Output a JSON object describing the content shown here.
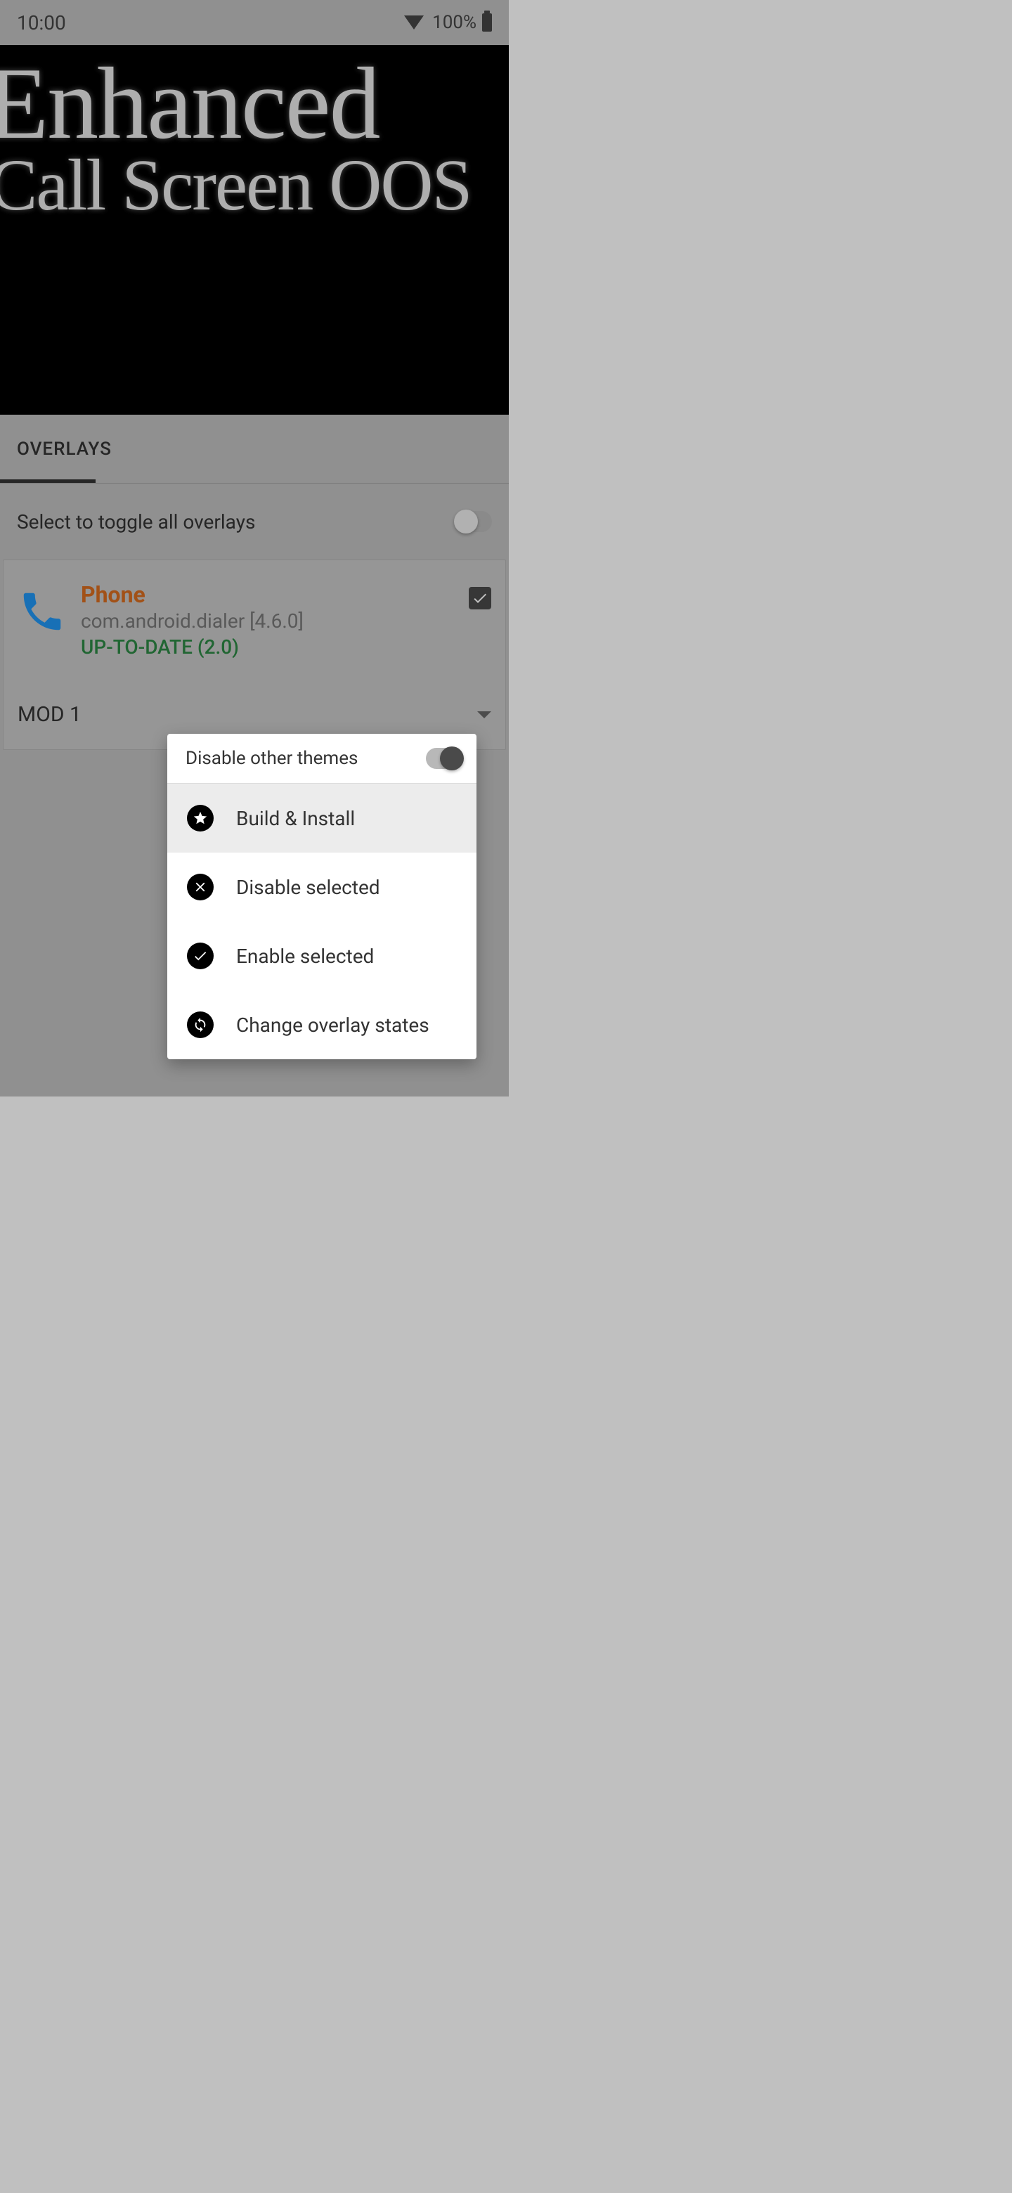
{
  "statusBar": {
    "time": "10:00",
    "batteryText": "100%"
  },
  "hero": {
    "line1": "Enhanced",
    "line2": "Call Screen OOS"
  },
  "tabs": {
    "overlays": "OVERLAYS"
  },
  "toggleAll": {
    "label": "Select to toggle all overlays"
  },
  "overlayCard": {
    "name": "Phone",
    "package": "com.android.dialer [4.6.0]",
    "status": "UP-TO-DATE (2.0)",
    "mod": "MOD 1"
  },
  "popup": {
    "header": "Disable other themes",
    "items": [
      {
        "label": "Build & Install",
        "icon": "star"
      },
      {
        "label": "Disable selected",
        "icon": "close"
      },
      {
        "label": "Enable selected",
        "icon": "check"
      },
      {
        "label": "Change overlay states",
        "icon": "sync"
      }
    ]
  }
}
